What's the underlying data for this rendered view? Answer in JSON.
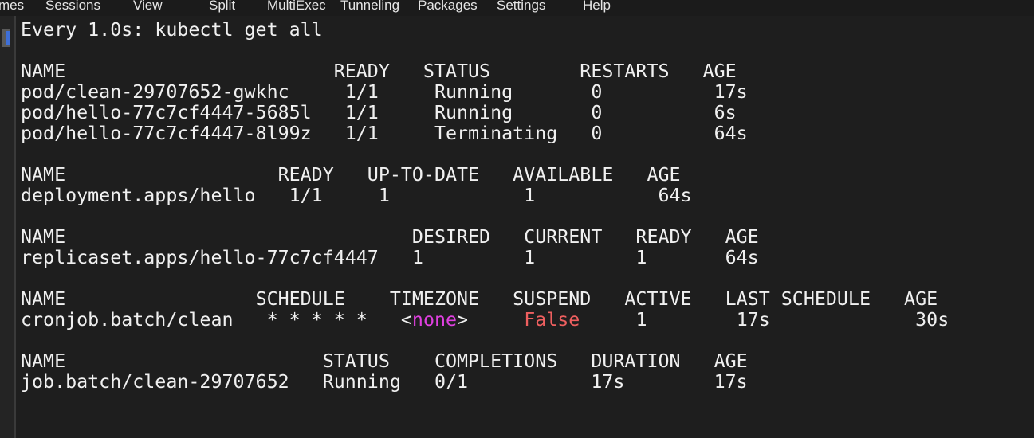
{
  "menubar": {
    "items": [
      "mes",
      "Sessions",
      "View",
      "Split",
      "MultiExec",
      "Tunneling",
      "Packages",
      "Settings",
      "Help"
    ]
  },
  "terminal": {
    "watch_header": "Every 1.0s: kubectl get all",
    "pods": {
      "header": "NAME                        READY   STATUS        RESTARTS   AGE",
      "rows": [
        "pod/clean-29707652-gwkhc     1/1     Running       0          17s",
        "pod/hello-77c7cf4447-5685l   1/1     Running       0          6s",
        "pod/hello-77c7cf4447-8l99z   1/1     Terminating   0          64s"
      ]
    },
    "deployments": {
      "header": "NAME                   READY   UP-TO-DATE   AVAILABLE   AGE",
      "rows": [
        "deployment.apps/hello   1/1     1            1           64s"
      ]
    },
    "replicasets": {
      "header": "NAME                               DESIRED   CURRENT   READY   AGE",
      "rows": [
        "replicaset.apps/hello-77c7cf4447   1         1         1       64s"
      ]
    },
    "cronjobs": {
      "header": "NAME                 SCHEDULE    TIMEZONE   SUSPEND   ACTIVE   LAST SCHEDULE   AGE",
      "row": {
        "name": "cronjob.batch/clean",
        "schedule": "* * * * *",
        "timezone_open": "<",
        "timezone_value": "none",
        "timezone_close": ">",
        "suspend": "False",
        "active": "1",
        "last_schedule": "17s",
        "age": "30s"
      }
    },
    "jobs": {
      "header": "NAME                       STATUS    COMPLETIONS   DURATION   AGE",
      "rows": [
        "job.batch/clean-29707652   Running   0/1           17s        17s"
      ]
    }
  },
  "colors": {
    "background": "#1e1e1e",
    "text": "#f0f0f0",
    "timezone_none": "#e040e0",
    "suspend_false": "#ee5f5f",
    "gutter_accent": "#3e6fd8"
  }
}
